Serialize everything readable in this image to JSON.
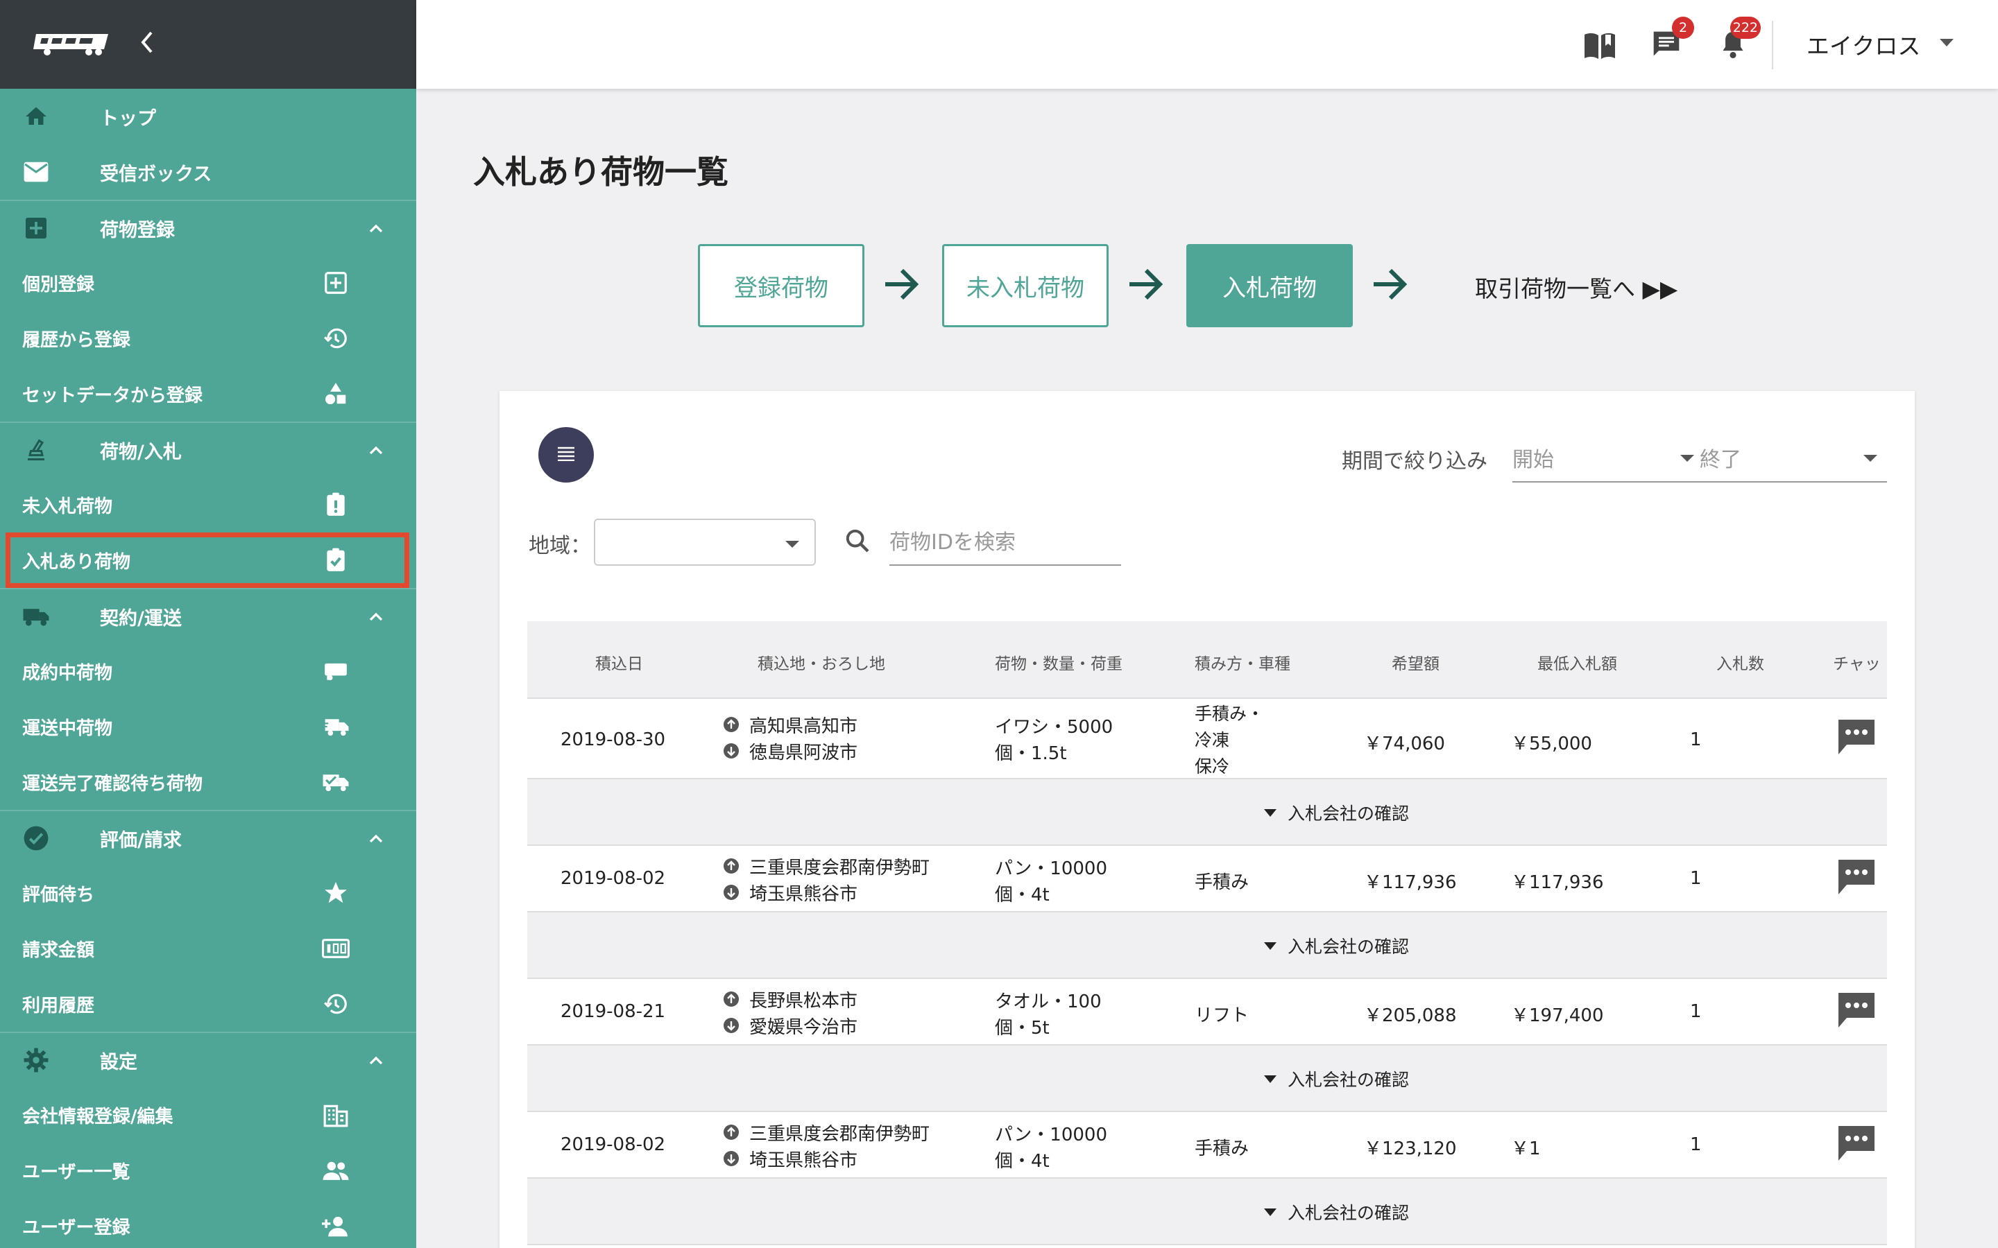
{
  "sidebar": {
    "top_items": [
      {
        "label": "トップ",
        "icon": "home-icon"
      },
      {
        "label": "受信ボックス",
        "icon": "mail-icon"
      }
    ],
    "sections": [
      {
        "label": "荷物登録",
        "icon": "add-box-icon",
        "items": [
          {
            "label": "個別登録",
            "icon": "add-square-icon"
          },
          {
            "label": "履歴から登録",
            "icon": "history-icon"
          },
          {
            "label": "セットデータから登録",
            "icon": "shapes-icon"
          }
        ]
      },
      {
        "label": "荷物/入札",
        "icon": "scale-icon",
        "items": [
          {
            "label": "未入札荷物",
            "icon": "clipboard-alert-icon"
          },
          {
            "label": "入札あり荷物",
            "icon": "clipboard-check-icon",
            "active": true
          }
        ]
      },
      {
        "label": "契約/運送",
        "icon": "truck-icon",
        "items": [
          {
            "label": "成約中荷物",
            "icon": "truck-small-icon"
          },
          {
            "label": "運送中荷物",
            "icon": "truck-fast-icon"
          },
          {
            "label": "運送完了確認待ち荷物",
            "icon": "truck-check-icon"
          }
        ]
      },
      {
        "label": "評価/請求",
        "icon": "check-circle-icon",
        "items": [
          {
            "label": "評価待ち",
            "icon": "star-icon"
          },
          {
            "label": "請求金額",
            "icon": "meter-icon"
          },
          {
            "label": "利用履歴",
            "icon": "history-icon"
          }
        ]
      },
      {
        "label": "設定",
        "icon": "gear-icon",
        "items": [
          {
            "label": "会社情報登録/編集",
            "icon": "building-icon"
          },
          {
            "label": "ユーザー一覧",
            "icon": "users-icon"
          },
          {
            "label": "ユーザー登録",
            "icon": "user-add-icon"
          }
        ]
      }
    ]
  },
  "header": {
    "messages_badge": "2",
    "notifications_badge": "222",
    "user_name": "エイクロス"
  },
  "page": {
    "title": "入札あり荷物一覧",
    "steps": [
      "登録荷物",
      "未入札荷物",
      "入札荷物"
    ],
    "next_link": "取引荷物一覧へ ▶▶"
  },
  "filters": {
    "period_label": "期間で絞り込み",
    "start_placeholder": "開始",
    "end_placeholder": "終了",
    "region_label": "地域：",
    "search_placeholder": "荷物IDを検索"
  },
  "table": {
    "headers": [
      "積込日",
      "積込地・おろし地",
      "荷物・数量・荷重",
      "積み方・車種",
      "希望額",
      "最低入札額",
      "入札数",
      "チャッ"
    ],
    "rows": [
      {
        "date": "2019-08-30",
        "from": "高知県高知市",
        "to": "徳島県阿波市",
        "cargo1": "イワシ・5000",
        "cargo2": "個・1.5t",
        "method": [
          "手積み・",
          "冷凍",
          "保冷"
        ],
        "desired": "￥74,060",
        "min_bid": "￥55,000",
        "bids": "1"
      },
      {
        "date": "2019-08-02",
        "from": "三重県度会郡南伊勢町",
        "to": "埼玉県熊谷市",
        "cargo1": "パン・10000",
        "cargo2": "個・4t",
        "method": [
          "手積み"
        ],
        "desired": "￥117,936",
        "min_bid": "￥117,936",
        "bids": "1"
      },
      {
        "date": "2019-08-21",
        "from": "長野県松本市",
        "to": "愛媛県今治市",
        "cargo1": "タオル・100",
        "cargo2": "個・5t",
        "method": [
          "リフト"
        ],
        "desired": "￥205,088",
        "min_bid": "￥197,400",
        "bids": "1"
      },
      {
        "date": "2019-08-02",
        "from": "三重県度会郡南伊勢町",
        "to": "埼玉県熊谷市",
        "cargo1": "パン・10000",
        "cargo2": "個・4t",
        "method": [
          "手積み"
        ],
        "desired": "￥123,120",
        "min_bid": "￥1",
        "bids": "1"
      }
    ],
    "sub_label": "入札会社の確認"
  }
}
